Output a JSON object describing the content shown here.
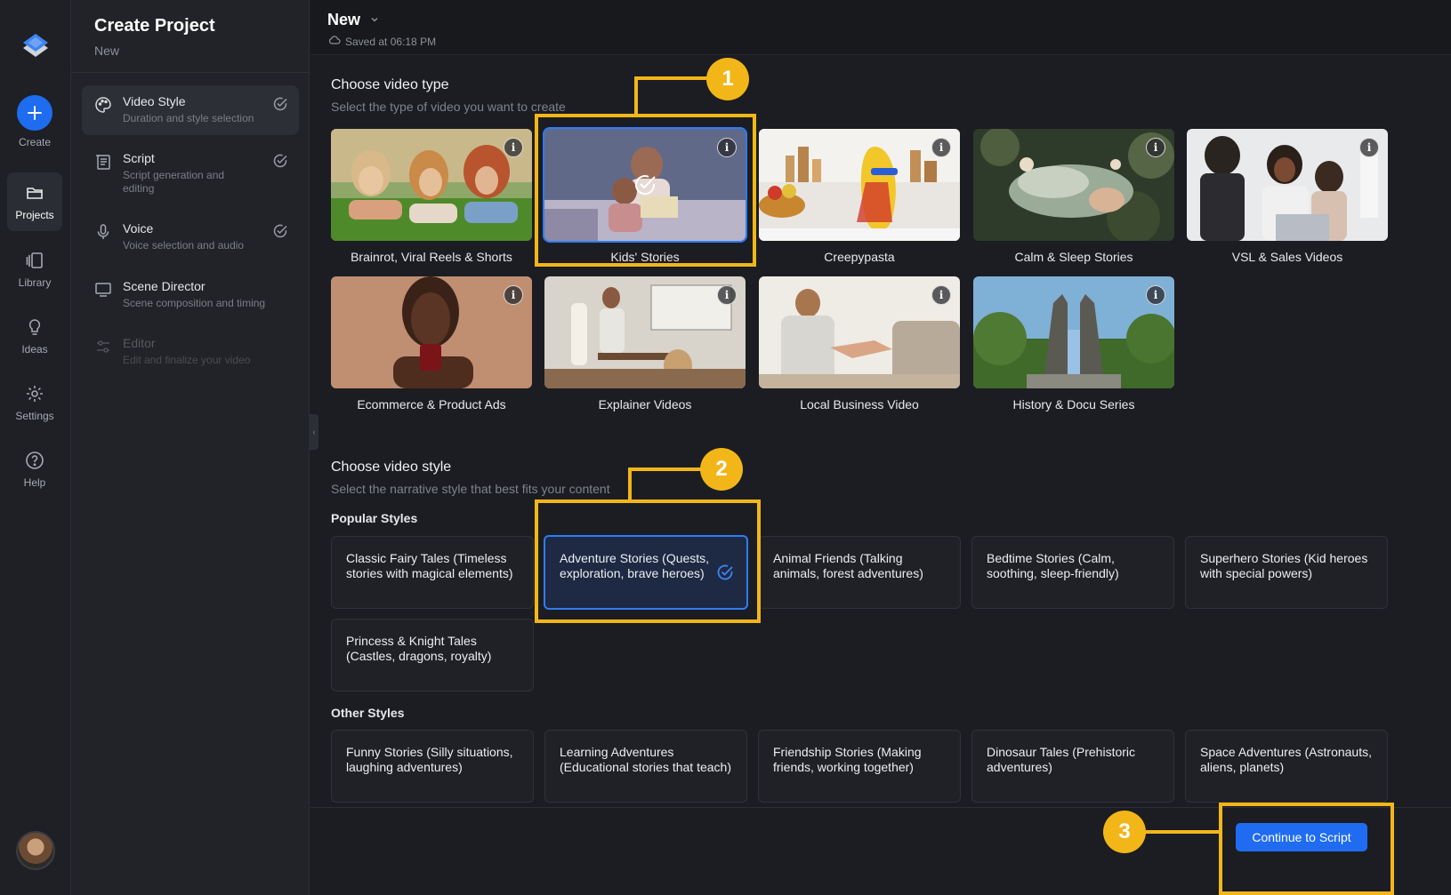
{
  "rail": {
    "items": [
      {
        "label": "Create",
        "icon": "plus-icon"
      },
      {
        "label": "Projects",
        "icon": "folder-icon"
      },
      {
        "label": "Library",
        "icon": "library-icon"
      },
      {
        "label": "Ideas",
        "icon": "lightbulb-icon"
      },
      {
        "label": "Settings",
        "icon": "gear-icon"
      },
      {
        "label": "Help",
        "icon": "help-icon"
      }
    ],
    "active": "Projects"
  },
  "steps_panel": {
    "title": "Create Project",
    "subtitle": "New",
    "steps": [
      {
        "title": "Video Style",
        "desc": "Duration and style selection",
        "icon": "palette-icon",
        "state": "active"
      },
      {
        "title": "Script",
        "desc": "Script generation and editing",
        "icon": "script-icon",
        "state": "done"
      },
      {
        "title": "Voice",
        "desc": "Voice selection and audio",
        "icon": "microphone-icon",
        "state": "done"
      },
      {
        "title": "Scene Director",
        "desc": "Scene composition and timing",
        "icon": "monitor-icon",
        "state": "pending"
      },
      {
        "title": "Editor",
        "desc": "Edit and finalize your video",
        "icon": "sliders-icon",
        "state": "disabled"
      }
    ]
  },
  "topbar": {
    "project_name": "New",
    "saved_text": "Saved at 06:18 PM"
  },
  "video_type": {
    "title": "Choose video type",
    "subtitle": "Select the type of video you want to create",
    "selected": "Kids' Stories",
    "items": [
      "Brainrot, Viral Reels & Shorts",
      "Kids' Stories",
      "Creepypasta",
      "Calm & Sleep Stories",
      "VSL & Sales Videos",
      "Ecommerce & Product Ads",
      "Explainer Videos",
      "Local Business Video",
      "History & Docu Series"
    ]
  },
  "video_style": {
    "title": "Choose video style",
    "subtitle": "Select the narrative style that best fits your content",
    "popular_title": "Popular Styles",
    "popular": [
      "Classic Fairy Tales (Timeless stories with magical elements)",
      "Adventure Stories (Quests, exploration, brave heroes)",
      "Animal Friends (Talking animals, forest adventures)",
      "Bedtime Stories (Calm, soothing, sleep-friendly)",
      "Superhero Stories (Kid heroes with special powers)",
      "Princess & Knight Tales (Castles, dragons, royalty)"
    ],
    "selected": "Adventure Stories (Quests, exploration, brave heroes)",
    "other_title": "Other Styles",
    "other": [
      "Funny Stories (Silly situations, laughing adventures)",
      "Learning Adventures (Educational stories that teach)",
      "Friendship Stories (Making friends, working together)",
      "Dinosaur Tales (Prehistoric adventures)",
      "Space Adventures (Astronauts, aliens, planets)"
    ]
  },
  "footer": {
    "continue_label": "Continue to Script"
  },
  "annotations": [
    "1",
    "2",
    "3"
  ],
  "colors": {
    "accent": "#1f6cf2",
    "annotation": "#f3b619",
    "background": "#1b1d22"
  }
}
